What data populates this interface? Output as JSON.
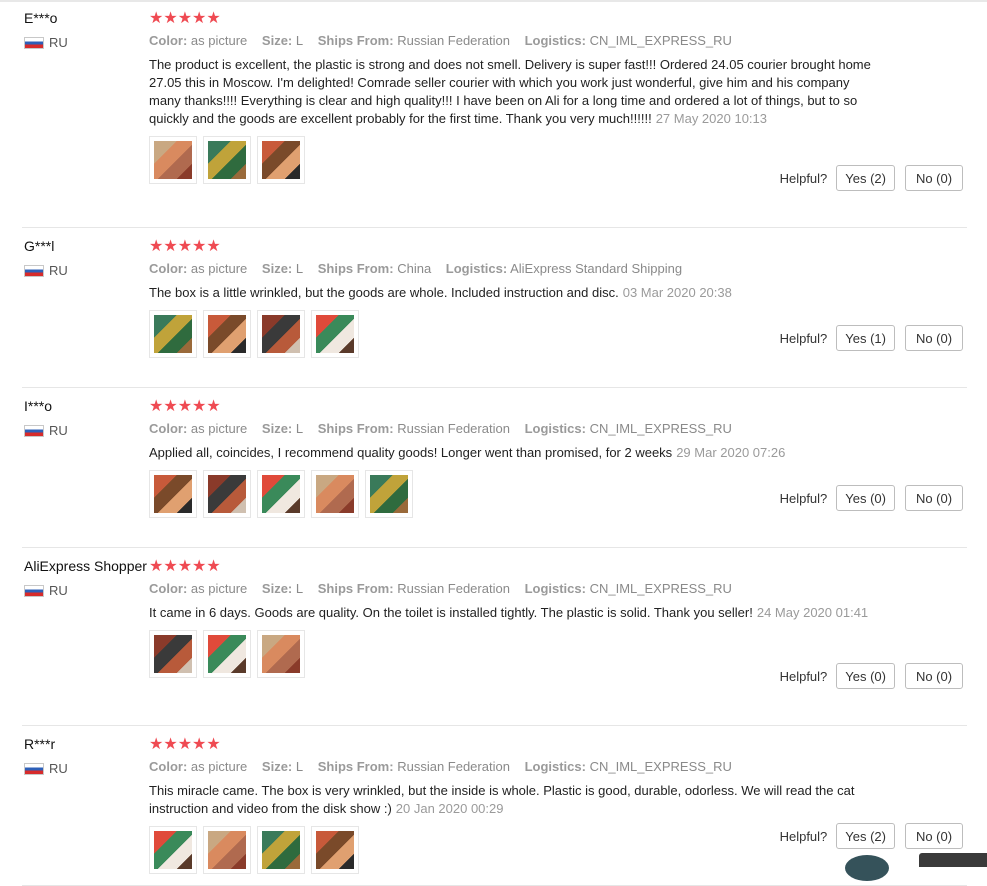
{
  "labels": {
    "color": "Color:",
    "size": "Size:",
    "ships_from": "Ships From:",
    "logistics": "Logistics:",
    "helpful": "Helpful?"
  },
  "colors": {
    "star": "#ef4a52",
    "flag_white": "#ffffff",
    "flag_blue": "#2d5fb8",
    "flag_red": "#d72b2b"
  },
  "reviews": [
    {
      "user": "E***o",
      "country": "RU",
      "rating": 5,
      "color": "as picture",
      "size": "L",
      "ships_from": "Russian Federation",
      "logistics": "CN_IML_EXPRESS_RU",
      "text": "The product is excellent, the plastic is strong and does not smell. Delivery is super fast!!! Ordered 24.05 courier brought home 27.05 this in Moscow. I'm delighted! Comrade seller courier with which you work just wonderful, give him and his company many thanks!!!! Everything is clear and high quality!!! I have been on Ali for a long time and ordered a lot of things, but to so quickly and the goods are excellent probably for the first time. Thank you very much!!!!!!",
      "date": "27 May 2020 10:13",
      "photo_count": 3,
      "yes": "Yes (2)",
      "no": "No (0)"
    },
    {
      "user": "G***l",
      "country": "RU",
      "rating": 5,
      "color": "as picture",
      "size": "L",
      "ships_from": "China",
      "logistics": "AliExpress Standard Shipping",
      "text": "The box is a little wrinkled, but the goods are whole. Included instruction and disc.",
      "date": "03 Mar 2020 20:38",
      "photo_count": 4,
      "yes": "Yes (1)",
      "no": "No (0)"
    },
    {
      "user": "I***o",
      "country": "RU",
      "rating": 5,
      "color": "as picture",
      "size": "L",
      "ships_from": "Russian Federation",
      "logistics": "CN_IML_EXPRESS_RU",
      "text": "Applied all, coincides, I recommend quality goods! Longer went than promised, for 2 weeks",
      "date": "29 Mar 2020 07:26",
      "photo_count": 5,
      "yes": "Yes (0)",
      "no": "No (0)"
    },
    {
      "user": "AliExpress Shopper",
      "country": "RU",
      "rating": 5,
      "color": "as picture",
      "size": "L",
      "ships_from": "Russian Federation",
      "logistics": "CN_IML_EXPRESS_RU",
      "text": "It came in 6 days. Goods are quality. On the toilet is installed tightly. The plastic is solid. Thank you seller!",
      "date": "24 May 2020 01:41",
      "photo_count": 3,
      "yes": "Yes (0)",
      "no": "No (0)"
    },
    {
      "user": "R***r",
      "country": "RU",
      "rating": 5,
      "color": "as picture",
      "size": "L",
      "ships_from": "Russian Federation",
      "logistics": "CN_IML_EXPRESS_RU",
      "text": "This miracle came. The box is very wrinkled, but the inside is whole. Plastic is good, durable, odorless. We will read the cat instruction and video from the disk show :)",
      "date": "20 Jan 2020 00:29",
      "photo_count": 4,
      "yes": "Yes (2)",
      "no": "No (0)"
    }
  ]
}
